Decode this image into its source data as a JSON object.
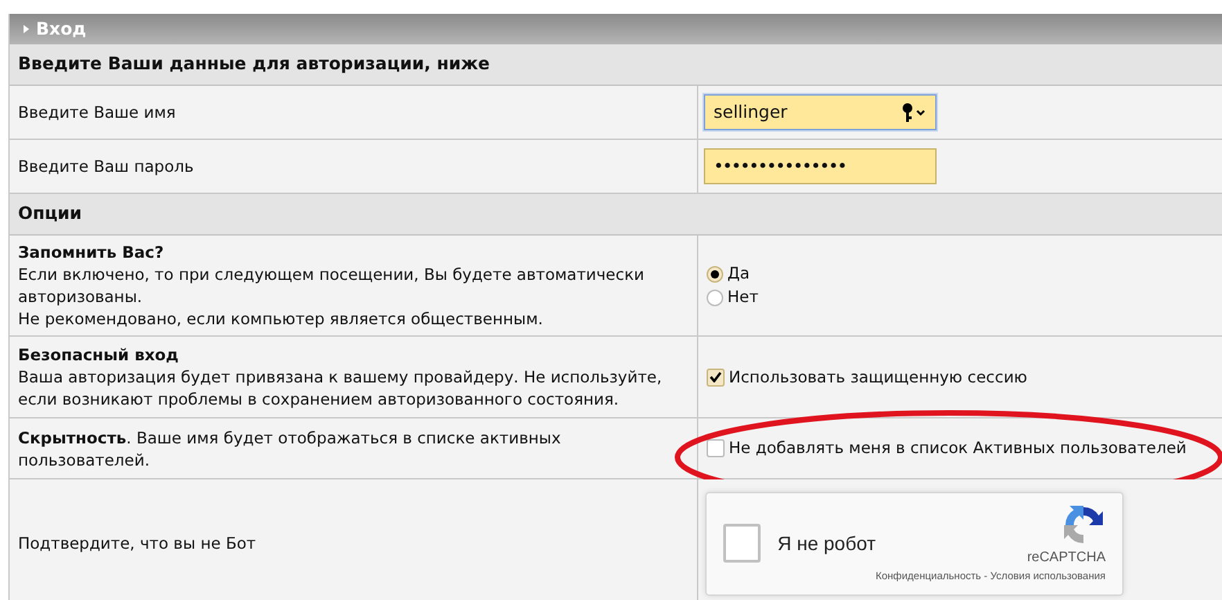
{
  "panel": {
    "title": "Вход"
  },
  "credentials": {
    "heading": "Введите Ваши данные для авторизации, ниже",
    "fields": [
      {
        "kind": "text",
        "label": "Введите Ваше имя",
        "value": "sellinger",
        "focused": true
      },
      {
        "kind": "password",
        "label": "Введите Ваш пароль",
        "value": "•••••••••••••••",
        "focused": false
      }
    ]
  },
  "options": {
    "heading": "Опции",
    "rows": [
      {
        "kind": "radio",
        "title": "Запомнить Вас?",
        "lines": [
          "Если включено, то при следующем посещении, Вы будете автоматически авторизованы.",
          "Не рекомендовано, если компьютер является общественным."
        ],
        "choices": [
          {
            "label": "Да",
            "selected": true
          },
          {
            "label": "Нет",
            "selected": false
          }
        ]
      },
      {
        "kind": "checkbox",
        "title": "Безопасный вход",
        "lines": [
          "Ваша авторизация будет привязана к вашему провайдеру. Не используйте, если возникают проблемы в сохранением авторизованного состояния."
        ],
        "choice": {
          "label": "Использовать защищенную сессию",
          "checked": true
        }
      },
      {
        "kind": "checkbox-inline",
        "text": "**Скрытность**. Ваше имя будет отображаться в списке активных пользователей.",
        "highlighted": true,
        "choice": {
          "label": "Не добавлять меня в список Активных пользователей",
          "checked": false
        }
      }
    ]
  },
  "captcha": {
    "label": "Подтвердите, что вы не Бот",
    "checkbox_label": "Я не робот",
    "checked": false,
    "brand": "reCAPTCHA",
    "links": [
      "Конфиденциальность",
      "Условия использования"
    ],
    "separator": "-"
  }
}
